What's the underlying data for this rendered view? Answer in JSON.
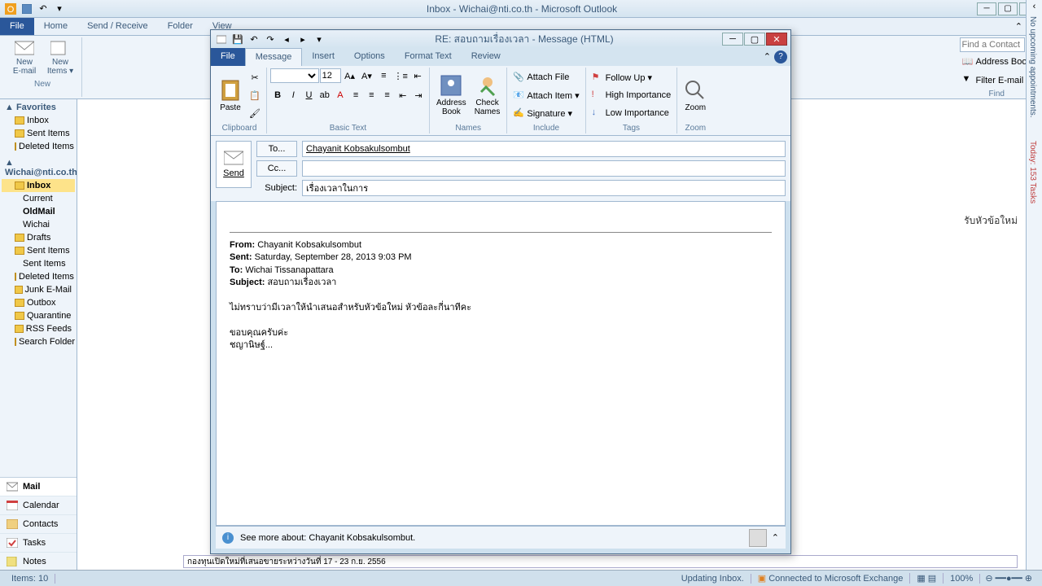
{
  "main": {
    "title": "Inbox - Wichai@nti.co.th - Microsoft Outlook",
    "tabs": [
      "File",
      "Home",
      "Send / Receive",
      "Folder",
      "View"
    ],
    "ribbon": {
      "new_email": "New\nE-mail",
      "new_items": "New\nItems ▾",
      "group_new": "New"
    },
    "find": {
      "contact_ph": "Find a Contact",
      "address_book": "Address Book",
      "filter": "Filter E-mail ▾",
      "group": "Find"
    }
  },
  "nav": {
    "favorites": "Favorites",
    "fav_items": [
      "Inbox",
      "Sent Items",
      "Deleted Items"
    ],
    "account": "Wichai@nti.co.th",
    "folders": [
      "Inbox",
      "Current",
      "OldMail",
      "Wichai",
      "Drafts",
      "Sent Items",
      "Sent Items",
      "Deleted Items",
      "Junk E-Mail",
      "Outbox",
      "Quarantine",
      "RSS Feeds",
      "Search Folders"
    ],
    "selected": "Inbox",
    "modules": [
      "Mail",
      "Calendar",
      "Contacts",
      "Tasks",
      "Notes"
    ]
  },
  "todo": {
    "no_appt": "No upcoming appointments.",
    "today": "Today: 153 Tasks"
  },
  "status": {
    "items": "Items: 10",
    "updating": "Updating Inbox.",
    "connected": "Connected to Microsoft Exchange",
    "zoom": "100%"
  },
  "compose": {
    "title": "RE: สอบถามเรื่องเวลา - Message (HTML)",
    "tabs": [
      "File",
      "Message",
      "Insert",
      "Options",
      "Format Text",
      "Review"
    ],
    "clipboard_group": "Clipboard",
    "paste": "Paste",
    "basic_text_group": "Basic Text",
    "font_size": "12",
    "names_group": "Names",
    "address_book": "Address\nBook",
    "check_names": "Check\nNames",
    "include_group": "Include",
    "attach_file": "Attach File",
    "attach_item": "Attach Item ▾",
    "signature": "Signature ▾",
    "tags_group": "Tags",
    "follow_up": "Follow Up ▾",
    "high_imp": "High Importance",
    "low_imp": "Low Importance",
    "zoom_group": "Zoom",
    "zoom": "Zoom",
    "send": "Send",
    "to_btn": "To...",
    "cc_btn": "Cc...",
    "subject_lbl": "Subject:",
    "to_val": "Chayanit Kobsakulsombut",
    "cc_val": "",
    "subject_val": "เรื่องเวลาในการ",
    "quoted": {
      "from_lbl": "From:",
      "from_val": "Chayanit Kobsakulsombut",
      "sent_lbl": "Sent:",
      "sent_val": "Saturday, September 28, 2013 9:03 PM",
      "to_lbl": "To:",
      "to_val": "Wichai Tissanapattara",
      "subj_lbl": "Subject:",
      "subj_val": "สอบถามเรื่องเวลา",
      "body1": "ไม่ทราบว่ามีเวลาให้นำเสนอสำหรับหัวข้อใหม่ หัวข้อละกี่นาทีคะ",
      "body2": "ขอบคุณครับค่ะ",
      "body3": "ชญานิษฐ์..."
    },
    "people": "See more about: Chayanit Kobsakulsombut."
  },
  "preview_snippet": "กองทุนเปิดใหม่ที่เสนอขายระหว่างวันที่ 17 - 23 ก.ย. 2556",
  "right_preview": "รับหัวข้อใหม่"
}
